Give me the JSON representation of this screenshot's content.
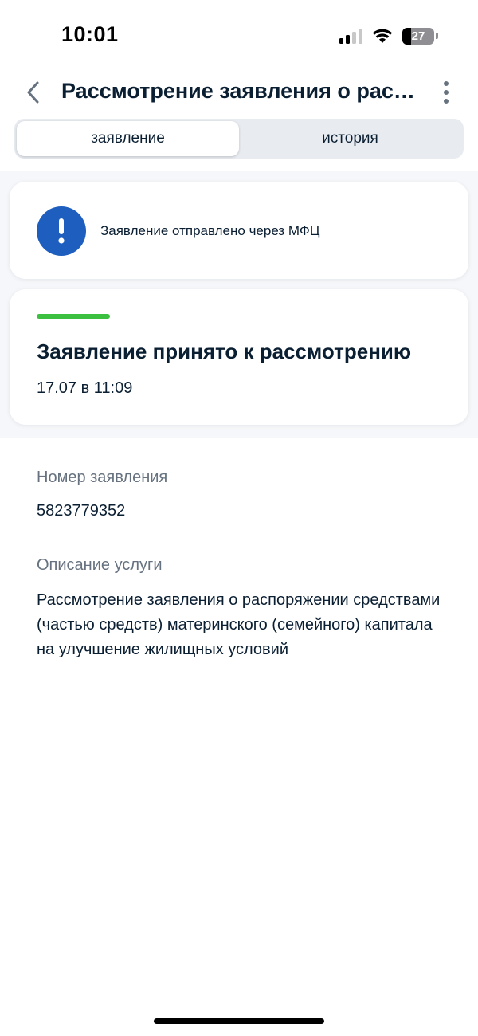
{
  "status_bar": {
    "time": "10:01",
    "battery_level": "27",
    "battery_fraction": 0.27,
    "signal_bars": 2,
    "signal_bars_total": 4
  },
  "header": {
    "title": "Рассмотрение заявления о распоряжении средствами (частью средств) материнского (семейного) капитала на улучшение жилищных условий",
    "back_icon": "chevron-left-icon",
    "menu_icon": "more-vertical-icon"
  },
  "tabs": [
    {
      "label": "заявление",
      "active": true
    },
    {
      "label": "история",
      "active": false
    }
  ],
  "notice": {
    "icon": "exclamation-icon",
    "text": "Заявление отправлено через МФЦ"
  },
  "status": {
    "progress": 0.25,
    "title": "Заявление принято к рассмотрению",
    "date": "17.07 в 11:09"
  },
  "details": {
    "number_label": "Номер заявления",
    "number_value": "5823779352",
    "description_label": "Описание услуги",
    "description_value": "Рассмотрение заявления о распоряжении средствами (частью средств) материнского (семейного) капитала на улучшение жилищных условий"
  },
  "colors": {
    "accent_blue": "#1e5ebf",
    "progress_green": "#3bc13f",
    "text_primary": "#0b1f33",
    "text_secondary": "#66727f",
    "background": "#f5f7fa"
  }
}
